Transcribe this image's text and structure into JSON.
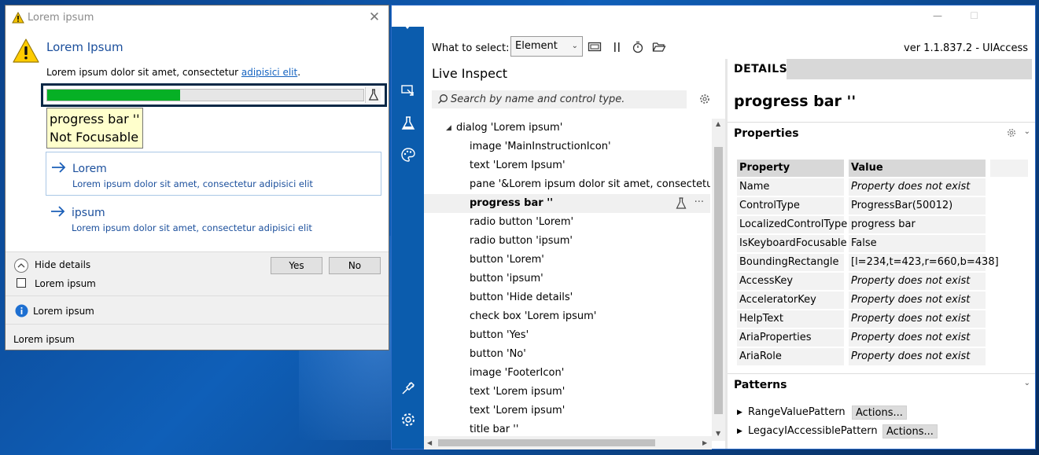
{
  "dialog": {
    "title": "Lorem ipsum",
    "main_instruction": "Lorem Ipsum",
    "content_text": "Lorem ipsum dolor sit amet, consectetur ",
    "content_link": "adipisici elit",
    "content_tail": ".",
    "progress_value_percent": 42,
    "tooltip_line1": "progress bar ''",
    "tooltip_line2": "Not Focusable",
    "command_links": [
      {
        "title": "Lorem",
        "description": "Lorem ipsum dolor sit amet, consectetur adipisici elit"
      },
      {
        "title": "ipsum",
        "description": "Lorem ipsum dolor sit amet, consectetur adipisici elit"
      }
    ],
    "expander_label": "Hide details",
    "checkbox_label": "Lorem ipsum",
    "yes_label": "Yes",
    "no_label": "No",
    "footer_text": "Lorem ipsum",
    "footnote_text": "Lorem ipsum"
  },
  "inspector": {
    "toolbar": {
      "what_to_select_label": "What to select:",
      "select_value": "Element",
      "version": "ver 1.1.837.2 - UIAccess"
    },
    "live_inspect": {
      "title": "Live Inspect",
      "search_placeholder": "Search by name and control type.",
      "tree": [
        {
          "text": "dialog 'Lorem ipsum'",
          "level": 0,
          "expanded": true
        },
        {
          "text": "image 'MainInstructionIcon'",
          "level": 1
        },
        {
          "text": "text 'Lorem Ipsum'",
          "level": 1
        },
        {
          "text": "pane '&Lorem ipsum dolor sit amet, consectetur adipisici elit'",
          "level": 1
        },
        {
          "text": "progress bar ''",
          "level": 1,
          "selected": true
        },
        {
          "text": "radio button 'Lorem'",
          "level": 1
        },
        {
          "text": "radio button 'ipsum'",
          "level": 1
        },
        {
          "text": "button 'Lorem'",
          "level": 1
        },
        {
          "text": "button 'ipsum'",
          "level": 1
        },
        {
          "text": "button 'Hide details'",
          "level": 1
        },
        {
          "text": "check box 'Lorem ipsum'",
          "level": 1
        },
        {
          "text": "button 'Yes'",
          "level": 1
        },
        {
          "text": "button 'No'",
          "level": 1
        },
        {
          "text": "image 'FooterIcon'",
          "level": 1
        },
        {
          "text": "text 'Lorem ipsum'",
          "level": 1
        },
        {
          "text": "text 'Lorem ipsum'",
          "level": 1
        },
        {
          "text": "title bar ''",
          "level": 1
        }
      ]
    },
    "details": {
      "tab": "DETAILS",
      "heading": "progress bar ''",
      "properties_label": "Properties",
      "patterns_label": "Patterns",
      "property_col": "Property",
      "value_col": "Value",
      "properties": [
        {
          "name": "Name",
          "value": "Property does not exist",
          "missing": true
        },
        {
          "name": "ControlType",
          "value": "ProgressBar(50012)",
          "missing": false
        },
        {
          "name": "LocalizedControlType",
          "value": "progress bar",
          "missing": false
        },
        {
          "name": "IsKeyboardFocusable",
          "value": "False",
          "missing": false
        },
        {
          "name": "BoundingRectangle",
          "value": "[l=234,t=423,r=660,b=438]",
          "missing": false
        },
        {
          "name": "AccessKey",
          "value": "Property does not exist",
          "missing": true
        },
        {
          "name": "AcceleratorKey",
          "value": "Property does not exist",
          "missing": true
        },
        {
          "name": "HelpText",
          "value": "Property does not exist",
          "missing": true
        },
        {
          "name": "AriaProperties",
          "value": "Property does not exist",
          "missing": true
        },
        {
          "name": "AriaRole",
          "value": "Property does not exist",
          "missing": true
        }
      ],
      "patterns": [
        {
          "name": "RangeValuePattern",
          "action": "Actions..."
        },
        {
          "name": "LegacyIAccessiblePattern",
          "action": "Actions..."
        }
      ]
    }
  },
  "colors": {
    "accent_blue": "#0b5cad",
    "progress_green": "#06b025",
    "tooltip_bg": "#ffffcc",
    "link_blue": "#1b4f9c"
  }
}
